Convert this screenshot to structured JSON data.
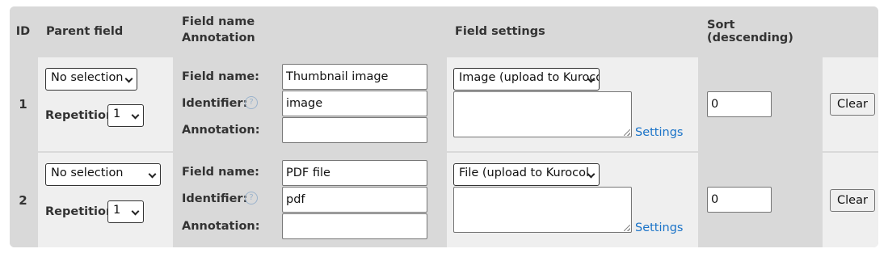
{
  "header": {
    "id": "ID",
    "parent_field": "Parent field",
    "field_name": "Field name",
    "annotation": "Annotation",
    "field_settings": "Field settings",
    "sort": "Sort (descending)"
  },
  "labels": {
    "repetition": "Repetition",
    "field_name": "Field name:",
    "identifier": "Identifier:",
    "annotation": "Annotation:",
    "settings_link": "Settings",
    "clear": "Clear",
    "help_glyph": "?"
  },
  "rows": [
    {
      "id": "1",
      "parent_select": "No selection",
      "repetition": "1",
      "field_name": "Thumbnail image",
      "identifier": "image",
      "annotation": "",
      "type_select": "Image (upload to Kuroco)",
      "settings_text": "",
      "sort": "0"
    },
    {
      "id": "2",
      "parent_select": "No selection",
      "repetition": "1",
      "field_name": "PDF file",
      "identifier": "pdf",
      "annotation": "",
      "type_select": "File (upload to Kurocol",
      "settings_text": "",
      "sort": "0"
    }
  ],
  "colors": {
    "header_bg": "#d9d9d9",
    "cell_light": "#efefef",
    "link": "#1a73c8"
  }
}
